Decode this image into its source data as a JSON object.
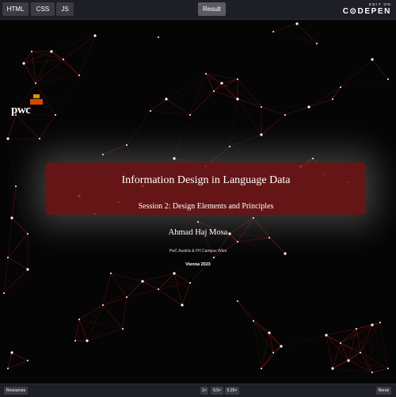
{
  "editor": {
    "tabs": {
      "html": "HTML",
      "css": "CSS",
      "js": "JS"
    },
    "result_label": "Result",
    "codepen_small": "EDIT ON",
    "codepen_big": "C⊙DEPEN"
  },
  "slide": {
    "logo_text": "pwc",
    "title": "Information Design in Language Data",
    "subtitle": "Session 2: Design Elements and Principles",
    "author": "Ahmad Haj Mosa",
    "affiliation": "PwC Austria & FH Campus Wien",
    "location": "Vienna 2023"
  },
  "footer": {
    "resources_label": "Resources",
    "zoom_options": [
      "1×",
      "0.5×",
      "0.25×"
    ],
    "rerun_label": "Rerun"
  },
  "colors": {
    "accent": "#7a1a1a",
    "line": "#b01818",
    "node": "#ffffff",
    "pwc_orange": "#d04a02"
  }
}
